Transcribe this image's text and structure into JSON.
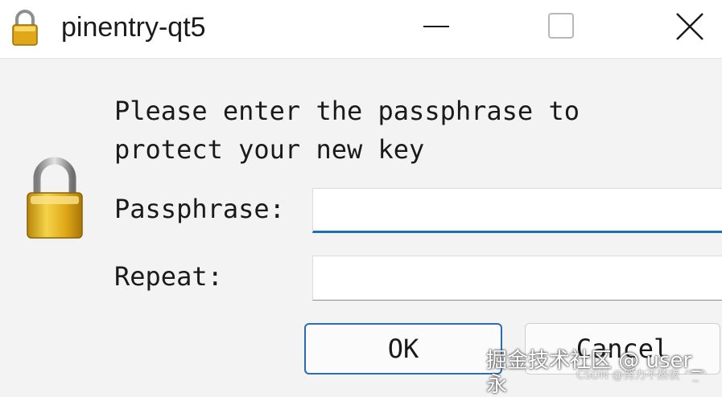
{
  "window": {
    "title": "pinentry-qt5",
    "icon": "padlock-icon"
  },
  "controls": {
    "minimize_icon": "minimize-icon",
    "maximize_icon": "maximize-icon",
    "close_icon": "close-icon"
  },
  "dialog": {
    "prompt_line1": "Please enter the passphrase to",
    "prompt_line2": "protect your new key",
    "passphrase_label": "Passphrase:",
    "passphrase_value": "",
    "repeat_label": "Repeat:",
    "repeat_value": "",
    "ok_label": "OK",
    "cancel_label": "Cancel"
  },
  "watermark": {
    "line1": "掘金技术社区 @ user_永",
    "line2": "CSDN @努力不熬夜 ^_^"
  },
  "colors": {
    "accent": "#1a6fbf",
    "lock_gold": "#d9a514",
    "background": "#f3f3f3"
  }
}
